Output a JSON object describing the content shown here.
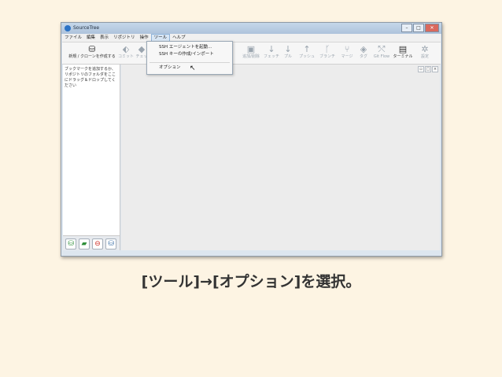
{
  "window": {
    "title": "SourceTree",
    "minimize": "–",
    "maximize": "□",
    "close": "✕"
  },
  "menu": [
    "ファイル",
    "編集",
    "表示",
    "リポジトリ",
    "操作",
    "ツール",
    "ヘルプ"
  ],
  "toolbar": {
    "new_clone": "新規 / クローンを作成する",
    "commit": "コミット",
    "checkout": "チェッ",
    "add_remove": "追加/削除",
    "fetch": "フェッチ",
    "pull": "プル",
    "push": "プッシュ",
    "branch": "ブランチ",
    "merge": "マージ",
    "tag": "タグ",
    "git_flow": "Git Flow",
    "terminal": "ターミナル",
    "settings": "設定"
  },
  "sidebar": {
    "hint": "ブックマークを追加するか、リポジトリのフォルダをここにドラッグ＆ドロップしてください"
  },
  "dropdown": {
    "items": [
      "SSH エージェントを起動...",
      "SSH キーの作成/インポート",
      "オプション"
    ]
  },
  "caption": "[ツール]→[オプション]を選択。"
}
